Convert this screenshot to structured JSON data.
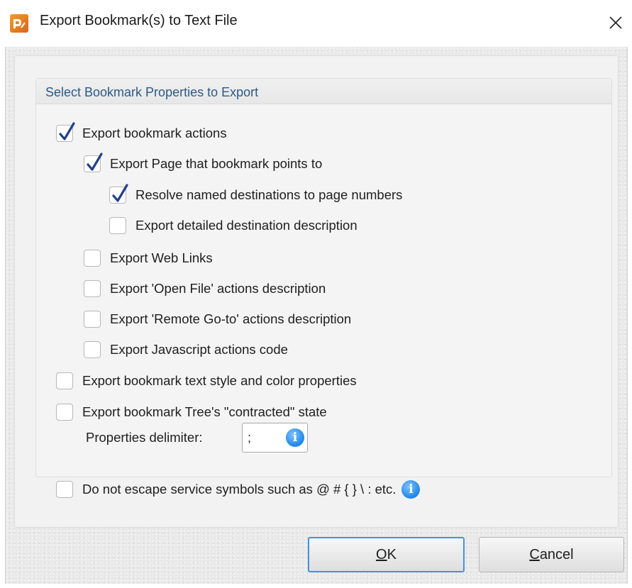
{
  "window": {
    "title": "Export Bookmark(s) to Text File",
    "icons": {
      "app": "app-logo-icon",
      "close": "close-icon"
    }
  },
  "group": {
    "title": "Select Bookmark Properties to Export"
  },
  "options": [
    {
      "label": "Export bookmark actions",
      "checked": true
    },
    {
      "label": "Export Page that bookmark points to",
      "checked": true
    },
    {
      "label": "Resolve named destinations to page numbers",
      "checked": true
    },
    {
      "label": "Export detailed destination description",
      "checked": false
    },
    {
      "label": "Export Web Links",
      "checked": false
    },
    {
      "label": "Export 'Open File' actions description",
      "checked": false
    },
    {
      "label": "Export 'Remote Go-to' actions description",
      "checked": false
    },
    {
      "label": "Export Javascript actions code",
      "checked": false
    },
    {
      "label": "Export bookmark text style and color properties",
      "checked": false
    },
    {
      "label": "Export bookmark Tree's \"contracted\" state",
      "checked": false
    }
  ],
  "delimiter": {
    "label": "Properties delimiter:",
    "value": ";"
  },
  "escape_option": {
    "label": "Do not escape service symbols such as @ # { } \\ : etc.",
    "checked": false
  },
  "buttons": {
    "ok_underlined": "O",
    "ok_rest": "K",
    "cancel_underlined": "C",
    "cancel_rest": "ancel"
  },
  "colors": {
    "accent": "#2a5a86",
    "focus_border": "#4a90d9",
    "info": "#1e86e6"
  }
}
